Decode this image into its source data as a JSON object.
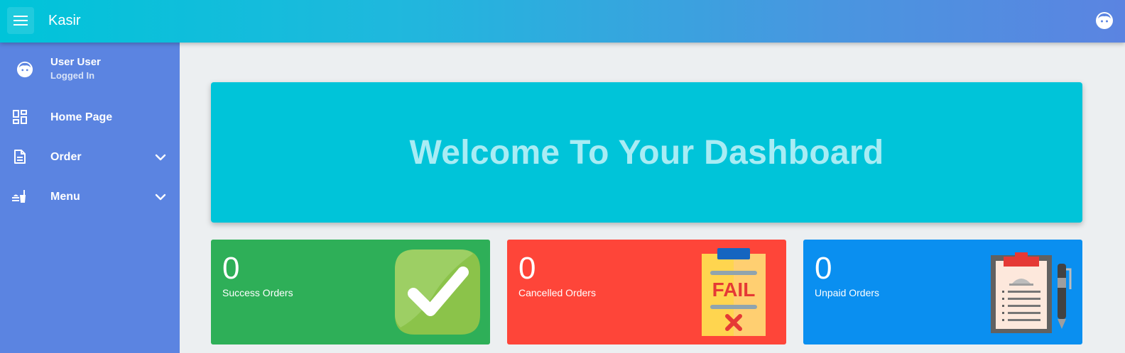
{
  "header": {
    "title": "Kasir",
    "menu_icon": "hamburger-icon",
    "profile_icon": "user-face-icon"
  },
  "sidebar": {
    "user": {
      "name": "User User",
      "status": "Logged In"
    },
    "items": [
      {
        "label": "Home Page",
        "icon": "dashboard-icon",
        "expandable": false
      },
      {
        "label": "Order",
        "icon": "document-icon",
        "expandable": true
      },
      {
        "label": "Menu",
        "icon": "food-drink-icon",
        "expandable": true
      }
    ]
  },
  "main": {
    "welcome_text": "Welcome To Your Dashboard",
    "stats": [
      {
        "value": "0",
        "label": "Success Orders",
        "color": "#2eaf58",
        "icon": "checkmark-icon"
      },
      {
        "value": "0",
        "label": "Cancelled Orders",
        "color": "#fe4539",
        "icon": "fail-clipboard-icon"
      },
      {
        "value": "0",
        "label": "Unpaid Orders",
        "color": "#0a8ff0",
        "icon": "order-clipboard-icon"
      }
    ],
    "fail_stamp": "FAIL"
  },
  "colors": {
    "topbar_start": "#00c4d9",
    "topbar_end": "#5b84e1",
    "sidebar": "#5b84e1",
    "welcome_bg": "#00c4d9",
    "welcome_text": "#a8ecf4",
    "page_bg": "#eceff1"
  }
}
